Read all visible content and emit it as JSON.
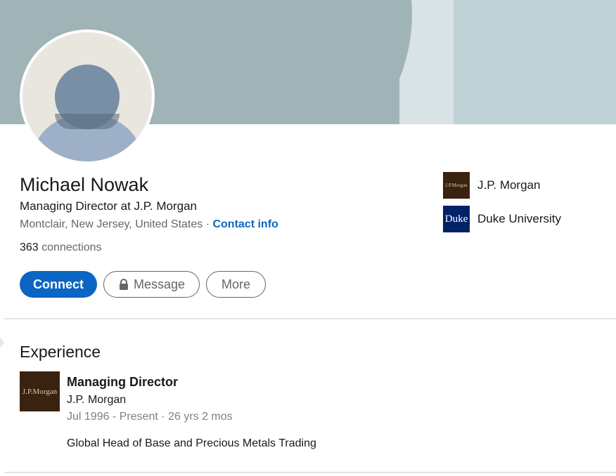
{
  "profile": {
    "name": "Michael Nowak",
    "headline": "Managing Director at J.P. Morgan",
    "location": "Montclair, New Jersey, United States",
    "separator": " · ",
    "contact_info": "Contact info",
    "connections_count": "363",
    "connections_label": " connections"
  },
  "actions": {
    "connect": "Connect",
    "message": "Message",
    "more": "More"
  },
  "side": {
    "company": {
      "label": "J.P. Morgan",
      "logo_text": "J.P.Morgan"
    },
    "school": {
      "label": "Duke University",
      "logo_text": "Duke"
    }
  },
  "experience": {
    "title": "Experience",
    "items": [
      {
        "logo_text": "J.P.Morgan",
        "role": "Managing Director",
        "company": "J.P. Morgan",
        "dates": "Jul 1996 - Present · 26 yrs 2 mos",
        "description": "Global Head of Base and Precious Metals Trading"
      }
    ]
  },
  "colors": {
    "primary_blue": "#0a66c2",
    "cover": "#a0b4b7",
    "jpm_brown": "#3a2210",
    "duke_navy": "#012169"
  }
}
